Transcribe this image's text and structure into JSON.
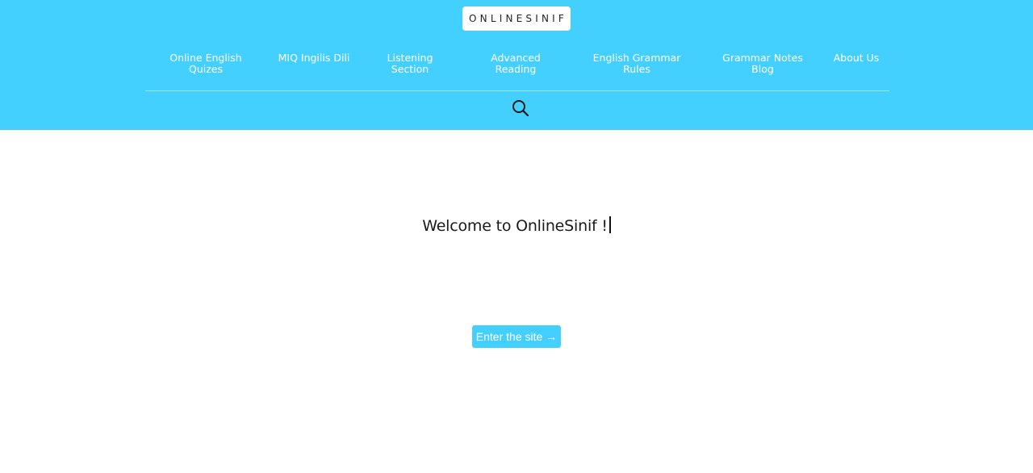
{
  "header": {
    "logo": "ONLINESINIF",
    "nav": [
      {
        "label": "Online English\nQuizes"
      },
      {
        "label": "MIQ Ingilis Dili"
      },
      {
        "label": "Listening\nSection"
      },
      {
        "label": "Advanced\nReading"
      },
      {
        "label": "English Grammar\nRules"
      },
      {
        "label": "Grammar Notes\nBlog"
      },
      {
        "label": "About Us"
      }
    ],
    "search_icon": "search-icon"
  },
  "main": {
    "welcome": "Welcome to OnlineSinif !",
    "enter_button": "Enter the site →"
  },
  "colors": {
    "header_bg": "#44d0fe",
    "button_bg": "#44d0fe",
    "text_dark": "#1a1a1a"
  }
}
